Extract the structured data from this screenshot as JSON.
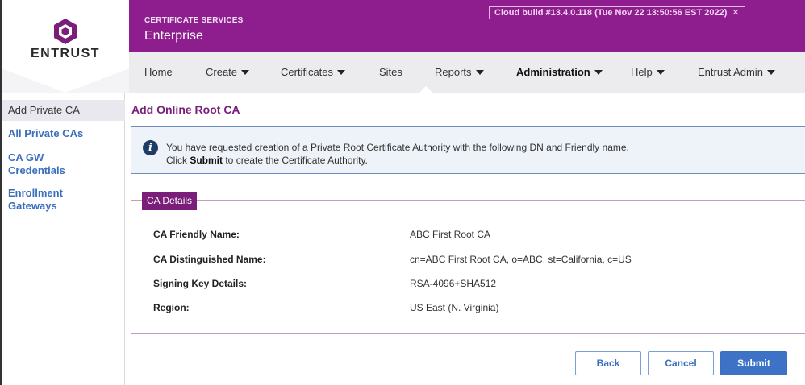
{
  "brand": {
    "logo_text": "ENTRUST",
    "service_title": "CERTIFICATE SERVICES",
    "service_subtitle": "Enterprise",
    "colors": {
      "header": "#8e1e8e",
      "accent": "#7a1e7a",
      "link": "#3a6fbd",
      "primary_button": "#3e72c6"
    }
  },
  "build_banner": {
    "text": "Cloud build #13.4.0.118 (Tue Nov 22 13:50:56 EST 2022)",
    "close_glyph": "✕"
  },
  "nav": {
    "items": [
      {
        "label": "Home",
        "has_dropdown": false
      },
      {
        "label": "Create",
        "has_dropdown": true
      },
      {
        "label": "Certificates",
        "has_dropdown": true
      },
      {
        "label": "Sites",
        "has_dropdown": false
      },
      {
        "label": "Reports",
        "has_dropdown": true
      },
      {
        "label": "Administration",
        "has_dropdown": true,
        "active": true
      },
      {
        "label": "Help",
        "has_dropdown": true
      },
      {
        "label": "Entrust Admin",
        "has_dropdown": true
      }
    ]
  },
  "sidebar": {
    "items": [
      {
        "label": "Add Private CA",
        "current": true
      },
      {
        "label": "All Private CAs"
      },
      {
        "label_line1": "CA GW",
        "label_line2": "Credentials"
      },
      {
        "label_line1": "Enrollment",
        "label_line2": "Gateways"
      }
    ]
  },
  "main": {
    "page_title": "Add Online Root CA",
    "info": {
      "icon": "info-icon",
      "line1": "You have requested creation of a Private Root Certificate Authority with the following DN and Friendly name.",
      "line2_prefix": "Click ",
      "line2_bold": "Submit",
      "line2_suffix": " to create the Certificate Authority."
    },
    "details": {
      "legend": "CA Details",
      "rows": [
        {
          "label": "CA Friendly Name:",
          "value": "ABC First Root CA"
        },
        {
          "label": "CA Distinguished Name:",
          "value": "cn=ABC First Root CA, o=ABC, st=California, c=US"
        },
        {
          "label": "Signing Key Details:",
          "value": "RSA-4096+SHA512"
        },
        {
          "label": "Region:",
          "value": "US East (N. Virginia)"
        }
      ]
    },
    "buttons": {
      "back": "Back",
      "cancel": "Cancel",
      "submit": "Submit"
    }
  }
}
